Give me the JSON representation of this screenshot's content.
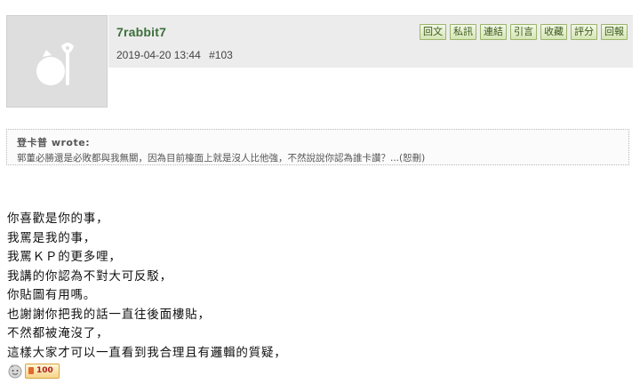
{
  "post": {
    "username": "7rabbit7",
    "timestamp": "2019-04-20 13:44",
    "post_number": "#103"
  },
  "actions": [
    {
      "label": "回文"
    },
    {
      "label": "私訊"
    },
    {
      "label": "連結"
    },
    {
      "label": "引言"
    },
    {
      "label": "收藏"
    },
    {
      "label": "評分"
    },
    {
      "label": "回報"
    }
  ],
  "quote": {
    "author": "登卡普 wrote:",
    "text": "郭董必勝還是必敗都與我無關，因為目前檯面上就是沒人比他強，不然說說你認為誰卡讚？...(恕刪)"
  },
  "body_lines": [
    "你喜歡是你的事，",
    "我罵是我的事，",
    "我罵ＫＰ的更多哩，",
    "我講的你認為不對大可反駁，",
    "你貼圖有用嗎。",
    "也謝謝你把我的話一直往後面樓貼，",
    "不然都被淹沒了，",
    "這樣大家才可以一直看到我合理且有邏輯的質疑，"
  ],
  "footer": {
    "score_value": "100"
  },
  "colors": {
    "username": "#3a6f3a",
    "meta_bar": "#ececec",
    "button_border": "#9bb56b",
    "avatar_bg": "#dedede"
  },
  "icons": {
    "avatar": "default-avatar-icon",
    "badge": "smiley-badge-icon"
  }
}
